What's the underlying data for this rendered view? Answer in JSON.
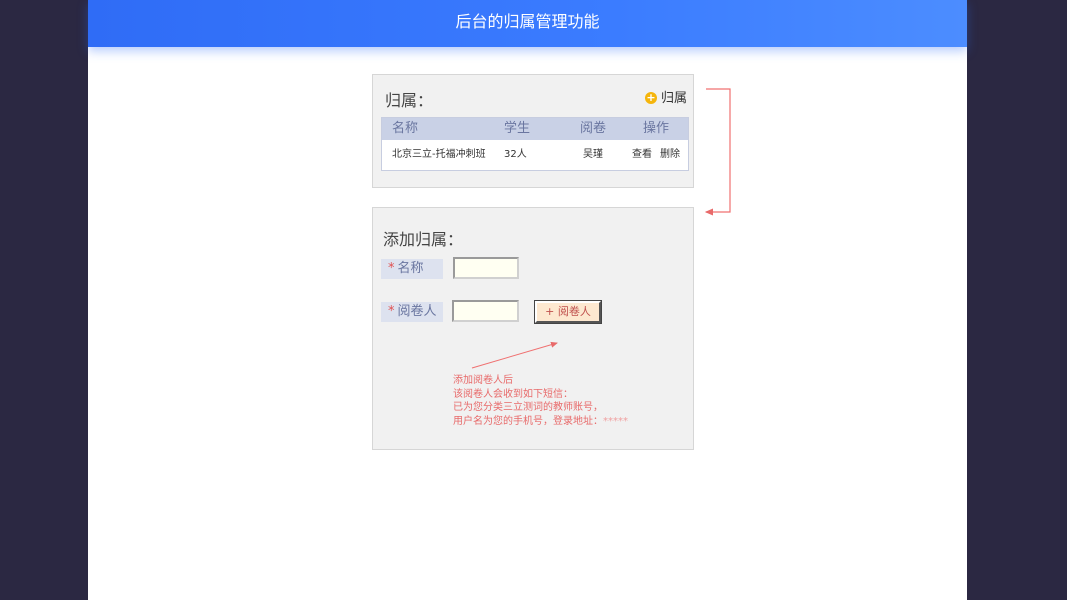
{
  "header": {
    "title": "后台的归属管理功能"
  },
  "ownership_panel": {
    "title": "归属：",
    "add_label": "归属",
    "columns": [
      "名称",
      "学生",
      "阅卷",
      "操作"
    ],
    "rows": [
      {
        "name": "北京三立-托福冲刺班",
        "students": "32人",
        "grader": "吴瑾",
        "view": "查看",
        "delete": "删除"
      }
    ]
  },
  "add_panel": {
    "title": "添加归属：",
    "required_mark": "*",
    "name_label": "名称",
    "name_value": "",
    "grader_label": "阅卷人",
    "grader_value": "",
    "add_grader_button": "+ 阅卷人",
    "note_lines": [
      "添加阅卷人后",
      "该阅卷人会收到如下短信：",
      "已为您分类三立测词的教师账号，",
      "用户名为您的手机号，登录地址："
    ],
    "note_stars": "*****"
  },
  "colors": {
    "header_blue": "#3b7cff",
    "annotation_red": "#e86a6a",
    "outer_bg": "#2b2842"
  }
}
